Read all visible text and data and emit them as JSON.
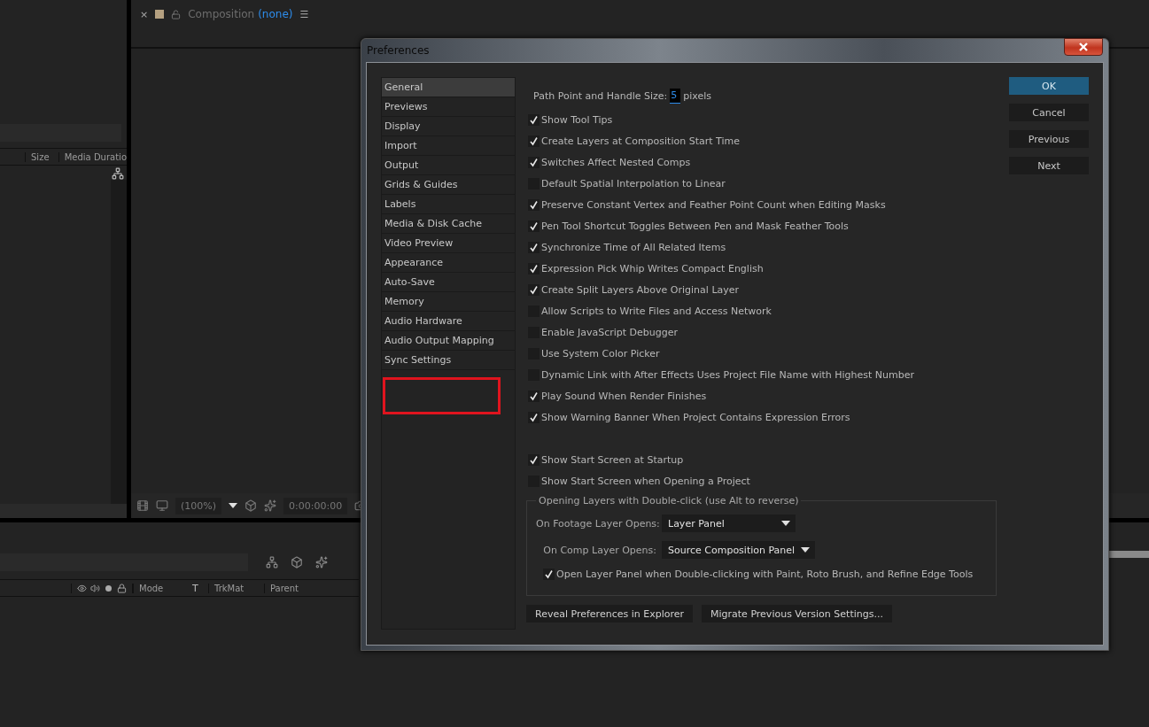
{
  "project_panel": {
    "columns": [
      "Size",
      "Media Duratio"
    ]
  },
  "composition_panel": {
    "close": "×",
    "title": "Composition",
    "comp_name": "(none)",
    "menu": "☰",
    "zoom": "(100%)",
    "timecode": "0:00:00:00"
  },
  "timeline": {
    "columns": [
      "Mode",
      "T",
      "TrkMat",
      "Parent"
    ]
  },
  "dialog": {
    "title": "Preferences",
    "categories": [
      {
        "label": "General",
        "selected": true
      },
      {
        "label": "Previews",
        "selected": false
      },
      {
        "label": "Display",
        "selected": false
      },
      {
        "label": "Import",
        "selected": false
      },
      {
        "label": "Output",
        "selected": false
      },
      {
        "label": "Grids & Guides",
        "selected": false
      },
      {
        "label": "Labels",
        "selected": false
      },
      {
        "label": "Media & Disk Cache",
        "selected": false
      },
      {
        "label": "Video Preview",
        "selected": false
      },
      {
        "label": "Appearance",
        "selected": false
      },
      {
        "label": "Auto-Save",
        "selected": false
      },
      {
        "label": "Memory",
        "selected": false
      },
      {
        "label": "Audio Hardware",
        "selected": false
      },
      {
        "label": "Audio Output Mapping",
        "selected": false
      },
      {
        "label": "Sync Settings",
        "selected": false
      }
    ],
    "path_point": {
      "label": "Path Point and Handle Size:",
      "value": "5",
      "unit": "pixels"
    },
    "options": [
      {
        "label": "Show Tool Tips",
        "checked": true
      },
      {
        "label": "Create Layers at Composition Start Time",
        "checked": true
      },
      {
        "label": "Switches Affect Nested Comps",
        "checked": true
      },
      {
        "label": "Default Spatial Interpolation to Linear",
        "checked": false
      },
      {
        "label": "Preserve Constant Vertex and Feather Point Count when Editing Masks",
        "checked": true
      },
      {
        "label": "Pen Tool Shortcut Toggles Between Pen and Mask Feather Tools",
        "checked": true
      },
      {
        "label": "Synchronize Time of All Related Items",
        "checked": true
      },
      {
        "label": "Expression Pick Whip Writes Compact English",
        "checked": true
      },
      {
        "label": "Create Split Layers Above Original Layer",
        "checked": true
      },
      {
        "label": "Allow Scripts to Write Files and Access Network",
        "checked": false
      },
      {
        "label": "Enable JavaScript Debugger",
        "checked": false
      },
      {
        "label": "Use System Color Picker",
        "checked": false
      },
      {
        "label": "Dynamic Link with After Effects Uses Project File Name with Highest Number",
        "checked": false
      },
      {
        "label": "Play Sound When Render Finishes",
        "checked": true
      },
      {
        "label": "Show Warning Banner When Project Contains Expression Errors",
        "checked": true
      }
    ],
    "startup_options": [
      {
        "label": "Show Start Screen at Startup",
        "checked": true
      },
      {
        "label": "Show Start Screen when Opening a Project",
        "checked": false
      }
    ],
    "double_click_group": {
      "title": "Opening Layers with Double-click (use Alt to reverse)",
      "dropdowns": [
        {
          "label": "On Footage Layer Opens:",
          "value": "Layer Panel"
        },
        {
          "label": "On Comp Layer Opens:",
          "value": "Source Composition Panel"
        }
      ],
      "option": {
        "label": "Open Layer Panel when Double-clicking with Paint, Roto Brush, and Refine Edge Tools",
        "checked": true
      }
    },
    "bottom_buttons": [
      "Reveal Preferences in Explorer",
      "Migrate Previous Version Settings..."
    ],
    "buttons": [
      {
        "label": "OK",
        "default": true
      },
      {
        "label": "Cancel",
        "default": false
      },
      {
        "label": "Previous",
        "default": false
      },
      {
        "label": "Next",
        "default": false
      }
    ]
  }
}
